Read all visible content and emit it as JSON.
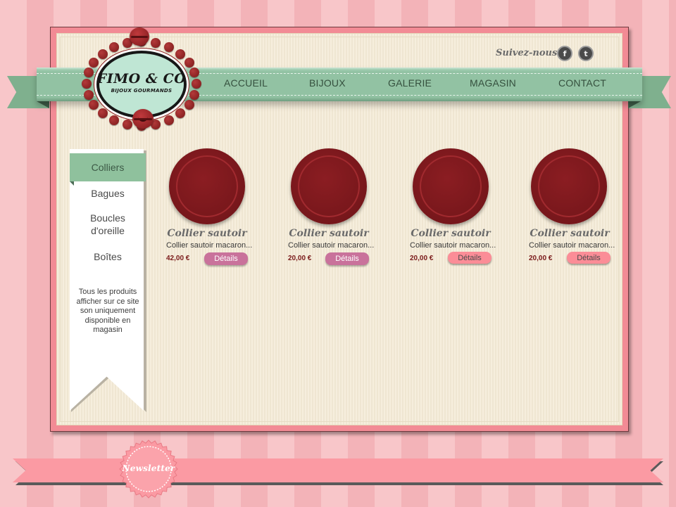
{
  "brand": {
    "title": "FIMO & CO",
    "subtitle": "BIJOUX GOURMANDS",
    "accent_color": "#92c2a3",
    "primary_color": "#f28b95",
    "macaron_color": "#8b1d22"
  },
  "header": {
    "follow_label": "Suivez-nous",
    "social": [
      {
        "icon": "facebook-icon",
        "glyph": "f"
      },
      {
        "icon": "twitter-icon",
        "glyph": "t"
      }
    ]
  },
  "nav": {
    "items": [
      "ACCUEIL",
      "BIJOUX",
      "GALERIE",
      "MAGASIN",
      "CONTACT"
    ]
  },
  "sidebar": {
    "items": [
      "Colliers",
      "Bagues",
      "Boucles d'oreille",
      "Boîtes"
    ],
    "active": "Colliers",
    "note": "Tous les produits afficher sur ce site son uniquement disponible en magasin"
  },
  "products": [
    {
      "title": "Collier sautoir",
      "desc": "Collier sautoir macaron...",
      "price": "42,00 €",
      "button": "Détails"
    },
    {
      "title": "Collier sautoir",
      "desc": "Collier sautoir macaron...",
      "price": "20,00 €",
      "button": "Détails"
    },
    {
      "title": "Collier sautoir",
      "desc": "Collier sautoir macaron...",
      "price": "20,00 €",
      "button": "Détails"
    },
    {
      "title": "Collier sautoir",
      "desc": "Collier sautoir macaron...",
      "price": "20,00 €",
      "button": "Détails"
    }
  ],
  "newsletter": {
    "label": "Newsletter"
  }
}
